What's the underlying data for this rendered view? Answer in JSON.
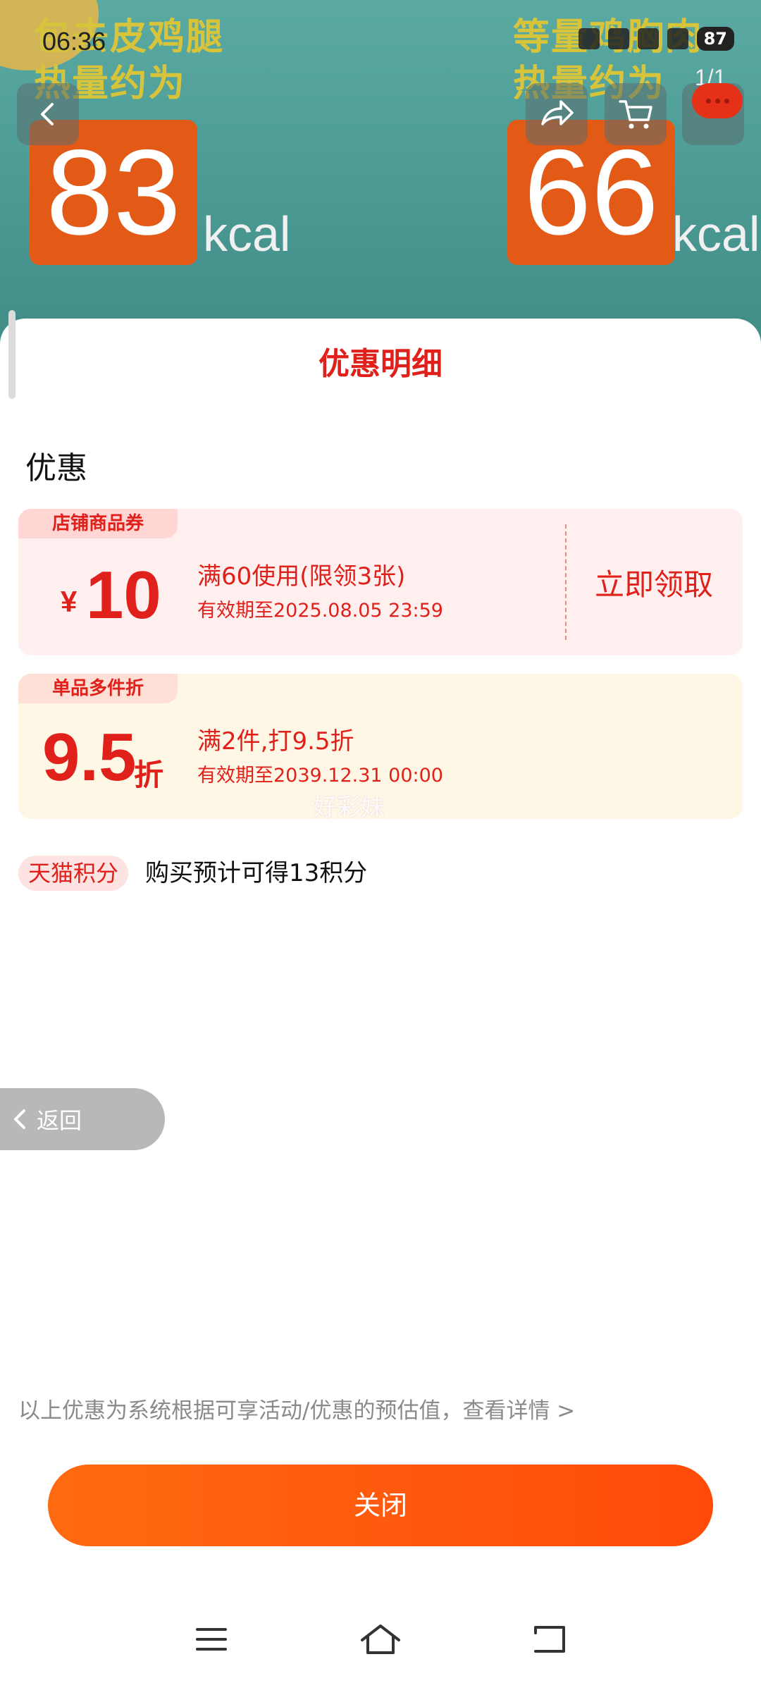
{
  "status_bar": {
    "time": "06:36",
    "battery": "87"
  },
  "background": {
    "caption_left": "包去皮鸡腿\n热量约为",
    "caption_right": "等量鸡胸肉\n热量约为",
    "kcal_left": "83",
    "kcal_right": "66",
    "kcal_unit": "kcal",
    "page_indicator": "1/1"
  },
  "sheet": {
    "title": "优惠明细",
    "section_title": "优惠",
    "coupons": [
      {
        "tag": "店铺商品券",
        "currency": "¥",
        "amount": "10",
        "condition": "满60使用(限领3张)",
        "validity": "有效期至2025.08.05 23:59",
        "action": "立即领取"
      },
      {
        "tag": "单品多件折",
        "amount": "9.5",
        "unit": "折",
        "condition": "满2件,打9.5折",
        "validity": "有效期至2039.12.31 00:00"
      }
    ],
    "watermark": "好彩妹",
    "points": {
      "badge": "天猫积分",
      "text": "购买预计可得13积分"
    },
    "back_pill": "返回",
    "disclaimer": "以上优惠为系统根据可享活动/优惠的预估值，查看详情 >",
    "close_label": "关闭"
  },
  "colors": {
    "accent_red": "#e0201a",
    "button_orange": "#ff5a0e",
    "coupon_red_bg": "#fff0ef",
    "coupon_yellow_bg": "#fff7e6"
  },
  "icons": [
    "back-chevron-icon",
    "share-icon",
    "cart-icon",
    "more-icon",
    "menu-icon",
    "home-icon",
    "return-icon"
  ]
}
